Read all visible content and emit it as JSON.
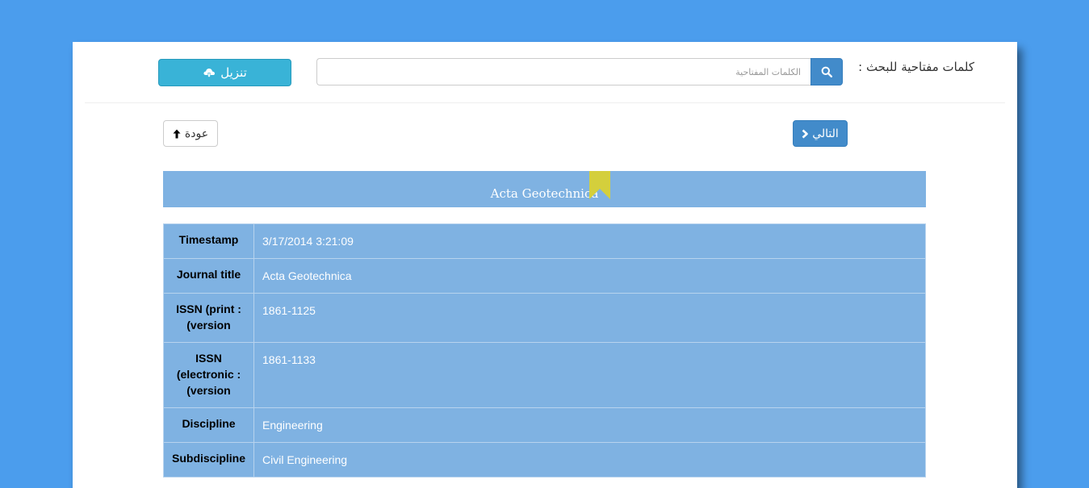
{
  "search": {
    "label": "كلمات مفتاحية للبحث :",
    "placeholder": "الكلمات المفتاحية",
    "button_icon": "search-icon"
  },
  "toolbar": {
    "download_label": "تنزيل",
    "download_icon": "cloud-download-icon",
    "back_label": "عودة",
    "back_icon": "arrow-up-icon",
    "next_label": "التالي",
    "next_icon": "chevron-right-icon"
  },
  "record": {
    "title": "Acta Geotechnica",
    "rows": [
      {
        "key": "Timestamp",
        "value": "3/17/2014 3:21:09"
      },
      {
        "key": "Journal title",
        "value": "Acta Geotechnica"
      },
      {
        "key": "ISSN (print :(version",
        "value": "1861-1125"
      },
      {
        "key": "ISSN (electronic :(version",
        "value": "1861-1133"
      },
      {
        "key": "Discipline",
        "value": "Engineering"
      },
      {
        "key": "Subdiscipline",
        "value": "Civil Engineering"
      }
    ]
  },
  "colors": {
    "background": "#4b9ded",
    "primary": "#428bca",
    "info": "#39b3d7",
    "table": "#7fb2e2",
    "ribbon": "#d4cf3c"
  }
}
